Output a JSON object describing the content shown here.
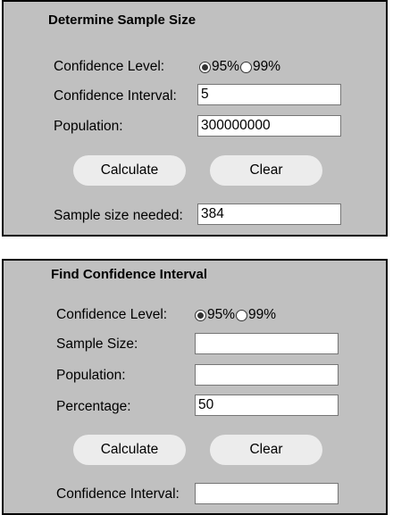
{
  "sample_size_panel": {
    "title": "Determine Sample Size",
    "confidence_level_label": "Confidence Level:",
    "option_95": "95%",
    "option_99": "99%",
    "selected_level": "95%",
    "confidence_interval_label": "Confidence Interval:",
    "confidence_interval_value": "5",
    "population_label": "Population:",
    "population_value": "300000000",
    "calculate_label": "Calculate",
    "clear_label": "Clear",
    "result_label": "Sample size needed:",
    "result_value": "384"
  },
  "confidence_interval_panel": {
    "title": "Find Confidence Interval",
    "confidence_level_label": "Confidence Level:",
    "option_95": "95%",
    "option_99": "99%",
    "selected_level": "95%",
    "sample_size_label": "Sample Size:",
    "sample_size_value": "",
    "population_label": "Population:",
    "population_value": "",
    "percentage_label": "Percentage:",
    "percentage_value": "50",
    "calculate_label": "Calculate",
    "clear_label": "Clear",
    "result_label": "Confidence Interval:",
    "result_value": ""
  }
}
